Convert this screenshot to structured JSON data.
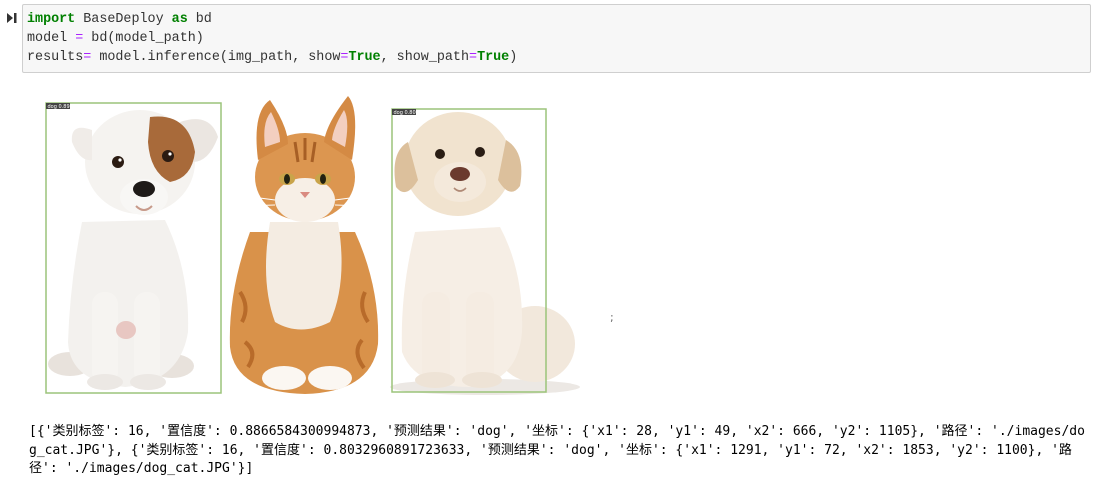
{
  "cell": {
    "lines": [
      [
        {
          "t": "import",
          "c": "kw"
        },
        {
          "t": " BaseDeploy ",
          "c": ""
        },
        {
          "t": "as",
          "c": "kw"
        },
        {
          "t": " bd",
          "c": ""
        }
      ],
      [
        {
          "t": "model ",
          "c": ""
        },
        {
          "t": "=",
          "c": "op"
        },
        {
          "t": " bd(model_path)",
          "c": ""
        }
      ],
      [
        {
          "t": "results",
          "c": ""
        },
        {
          "t": "=",
          "c": "op"
        },
        {
          "t": " model.inference(img_path, show",
          "c": ""
        },
        {
          "t": "=",
          "c": "op"
        },
        {
          "t": "True",
          "c": "kw"
        },
        {
          "t": ", show_path",
          "c": ""
        },
        {
          "t": "=",
          "c": "op"
        },
        {
          "t": "True",
          "c": "kw"
        },
        {
          "t": ")",
          "c": ""
        }
      ]
    ]
  },
  "output": {
    "detections": [
      {
        "label": "dog 0.89"
      },
      {
        "label": "dog 0.80"
      }
    ],
    "cursor_glyph": ";",
    "result_text": "[{'类别标签': 16, '置信度': 0.8866584300994873, '预测结果': 'dog', '坐标': {'x1': 28, 'y1': 49, 'x2': 666, 'y2': 1105}, '路径': './images/dog_cat.JPG'}, {'类别标签': 16, '置信度': 0.8032960891723633, '预测结果': 'dog', '坐标': {'x1': 1291, 'y1': 72, 'x2': 1853, 'y2': 1100}, '路径': './images/dog_cat.JPG'}]"
  },
  "colors": {
    "bbox": "#9bc47a",
    "keyword": "#008000",
    "operator": "#aa22ff",
    "cell_bg": "#f7f7f7"
  }
}
